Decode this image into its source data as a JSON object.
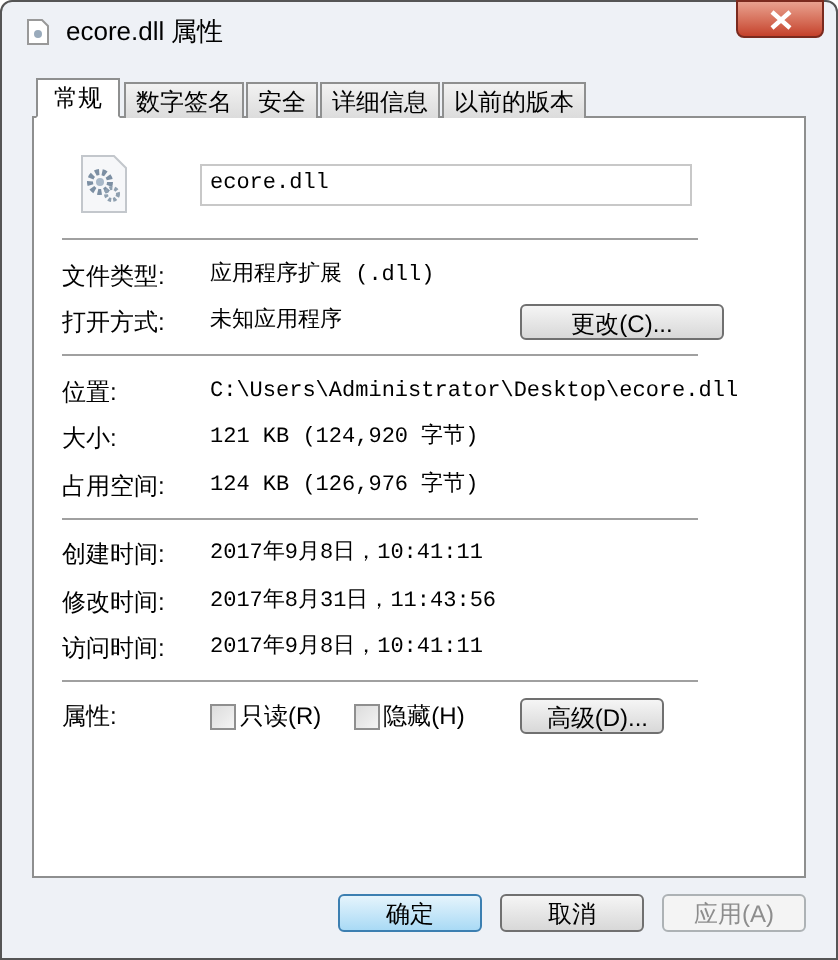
{
  "window": {
    "title": "ecore.dll 属性"
  },
  "tabs": [
    {
      "label": "常规",
      "selected": true
    },
    {
      "label": "数字签名",
      "selected": false
    },
    {
      "label": "安全",
      "selected": false
    },
    {
      "label": "详细信息",
      "selected": false
    },
    {
      "label": "以前的版本",
      "selected": false
    }
  ],
  "file_name": {
    "value": "ecore.dll"
  },
  "sections": [
    [
      {
        "label": "文件类型:",
        "value": "应用程序扩展 (.dll)"
      },
      {
        "label": "打开方式:",
        "value": "未知应用程序",
        "button": "更改(C)..."
      }
    ],
    [
      {
        "label": "位置:",
        "value": "C:\\Users\\Administrator\\Desktop\\ecore.dll"
      },
      {
        "label": "大小:",
        "value": "121 KB (124,920 字节)"
      },
      {
        "label": "占用空间:",
        "value": "124 KB (126,976 字节)"
      }
    ],
    [
      {
        "label": "创建时间:",
        "value": "2017年9月8日，10:41:11"
      },
      {
        "label": "修改时间:",
        "value": "2017年8月31日，11:43:56"
      },
      {
        "label": "访问时间:",
        "value": "2017年9月8日，10:41:11"
      }
    ]
  ],
  "attributes": {
    "label": "属性:",
    "checkboxes": [
      {
        "label": "只读(R)",
        "checked": false
      },
      {
        "label": "隐藏(H)",
        "checked": false
      }
    ],
    "button": "高级(D)..."
  },
  "buttons": [
    {
      "label": "确定",
      "default": true,
      "disabled": false
    },
    {
      "label": "取消",
      "default": false,
      "disabled": false
    },
    {
      "label": "应用(A)",
      "default": false,
      "disabled": true
    }
  ]
}
